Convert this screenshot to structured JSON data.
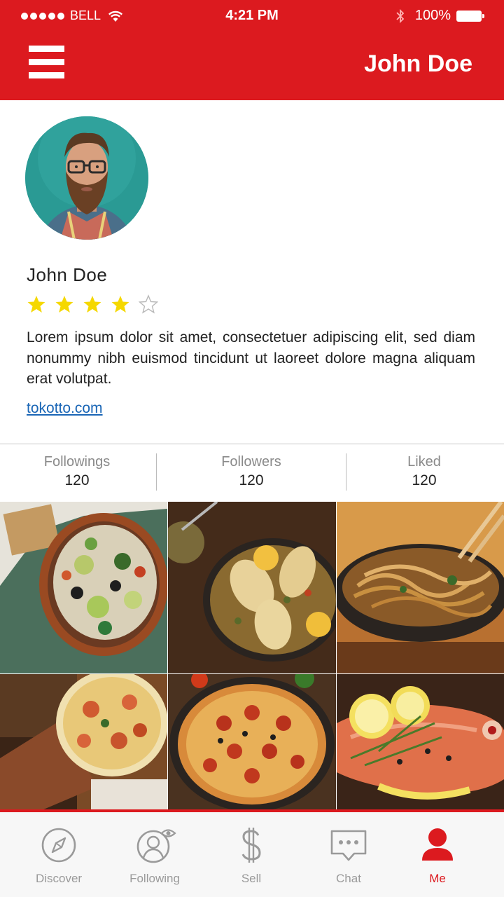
{
  "status_bar": {
    "carrier": "BELL",
    "time": "4:21 PM",
    "battery": "100%"
  },
  "nav": {
    "title": "John Doe",
    "menu_icon": "hamburger-menu-icon"
  },
  "profile": {
    "name": "John Doe",
    "rating": 4,
    "rating_max": 5,
    "bio": "Lorem ipsum dolor sit amet, consectetuer adipiscing elit, sed diam nonummy nibh euismod tincidunt ut laoreet dolore magna aliquam erat volutpat.",
    "website": "tokotto.com"
  },
  "stats": [
    {
      "label": "Followings",
      "value": "120"
    },
    {
      "label": "Followers",
      "value": "120"
    },
    {
      "label": "Liked",
      "value": "120"
    }
  ],
  "gallery": [
    {
      "subject": "salad-bowl-photo"
    },
    {
      "subject": "chicken-pan-photo"
    },
    {
      "subject": "spaghetti-photo"
    },
    {
      "subject": "pizza-board-photo"
    },
    {
      "subject": "pepperoni-pizza-photo"
    },
    {
      "subject": "fish-lemon-photo"
    }
  ],
  "tabs": [
    {
      "label": "Discover",
      "icon": "compass-icon",
      "active": false
    },
    {
      "label": "Following",
      "icon": "user-eye-icon",
      "active": false
    },
    {
      "label": "Sell",
      "icon": "dollar-icon",
      "active": false
    },
    {
      "label": "Chat",
      "icon": "chat-bubble-icon",
      "active": false
    },
    {
      "label": "Me",
      "icon": "person-icon",
      "active": true
    }
  ],
  "colors": {
    "brand_red": "#dc1a1f",
    "star_yellow": "#f5d800",
    "link_blue": "#1a66b6",
    "tab_inactive": "#9a9a9a"
  }
}
